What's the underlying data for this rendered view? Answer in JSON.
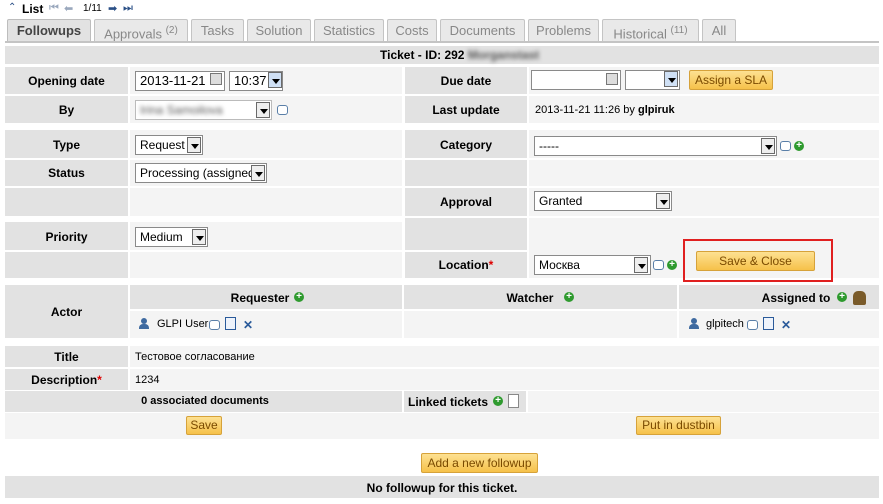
{
  "nav": {
    "list_label": "List",
    "counter": "1/11"
  },
  "tabs": [
    {
      "label": "Followups",
      "count": ""
    },
    {
      "label": "Approvals",
      "count": "(2)"
    },
    {
      "label": "Tasks",
      "count": ""
    },
    {
      "label": "Solution",
      "count": ""
    },
    {
      "label": "Statistics",
      "count": ""
    },
    {
      "label": "Costs",
      "count": ""
    },
    {
      "label": "Documents",
      "count": ""
    },
    {
      "label": "Problems",
      "count": ""
    },
    {
      "label": "Historical",
      "count": "(11)"
    },
    {
      "label": "All",
      "count": ""
    }
  ],
  "ticket": {
    "title": "Ticket - ID: 292",
    "title_hidden": "Morganstast"
  },
  "opening_date": {
    "label": "Opening date",
    "date": "2013-11-21",
    "time": "10:37"
  },
  "due_date": {
    "label": "Due date",
    "assign_sla": "Assign a SLA"
  },
  "by": {
    "label": "By",
    "value": "Irina Samoilova"
  },
  "last_update": {
    "label": "Last update",
    "value_prefix": "2013-11-21 11:26 by",
    "user": "glpiruk"
  },
  "type": {
    "label": "Type",
    "value": "Request"
  },
  "category": {
    "label": "Category",
    "value": "-----"
  },
  "status": {
    "label": "Status",
    "value": "Processing (assigned)"
  },
  "approval": {
    "label": "Approval",
    "value": "Granted"
  },
  "priority": {
    "label": "Priority",
    "value": "Medium"
  },
  "location": {
    "label": "Location",
    "required": "*",
    "value": "Москва"
  },
  "save_close": "Save & Close",
  "actor": {
    "label": "Actor",
    "requester": {
      "label": "Requester",
      "user": "GLPI User"
    },
    "watcher": {
      "label": "Watcher"
    },
    "assigned": {
      "label": "Assigned to",
      "user": "glpitech"
    }
  },
  "title": {
    "label": "Title",
    "value": "Тестовое согласование"
  },
  "description": {
    "label": "Description",
    "required": "*",
    "value": "1234"
  },
  "documents": {
    "label": "0 associated documents"
  },
  "linked": {
    "label": "Linked tickets"
  },
  "actions": {
    "save": "Save",
    "dustbin": "Put in dustbin",
    "add_followup": "Add a new followup"
  },
  "followup_status": "No followup for this ticket.",
  "colors": {
    "accent_border": "#e02020",
    "button_bg": "#f6c14a",
    "header_bg": "#e2e2e2",
    "row_bg": "#f4f4f4"
  }
}
